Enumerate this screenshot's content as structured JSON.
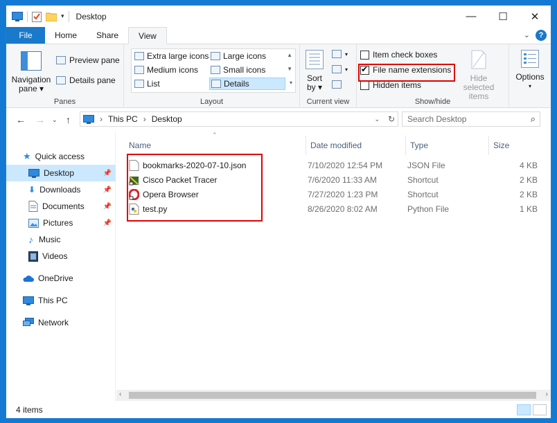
{
  "window": {
    "title": "Desktop",
    "minimize": "—",
    "maximize": "☐",
    "close": "✕"
  },
  "tabs": [
    {
      "label": "File"
    },
    {
      "label": "Home"
    },
    {
      "label": "Share"
    },
    {
      "label": "View"
    }
  ],
  "ribbon": {
    "panes": {
      "navigation_pane": "Navigation",
      "navigation_pane_2": "pane",
      "preview_pane": "Preview pane",
      "details_pane": "Details pane",
      "group_label": "Panes"
    },
    "layout": {
      "items": [
        "Extra large icons",
        "Large icons",
        "Medium icons",
        "Small icons",
        "List",
        "Details"
      ],
      "selected": "Details",
      "group_label": "Layout"
    },
    "current_view": {
      "sort_by": "Sort",
      "sort_by_2": "by",
      "group_label": "Current view"
    },
    "show_hide": {
      "item_check_boxes": "Item check boxes",
      "item_check_boxes_checked": false,
      "file_name_extensions": "File name extensions",
      "file_name_extensions_checked": true,
      "hidden_items": "Hidden items",
      "hidden_items_checked": false,
      "hide_selected": "Hide selected",
      "hide_selected_2": "items",
      "group_label": "Show/hide"
    },
    "options": {
      "label": "Options"
    }
  },
  "address": {
    "crumbs": [
      "This PC",
      "Desktop"
    ],
    "search_placeholder": "Search Desktop"
  },
  "nav": {
    "items": [
      {
        "label": "Quick access",
        "pinned": false
      },
      {
        "label": "Desktop",
        "pinned": true,
        "selected": true
      },
      {
        "label": "Downloads",
        "pinned": true
      },
      {
        "label": "Documents",
        "pinned": true
      },
      {
        "label": "Pictures",
        "pinned": true
      },
      {
        "label": "Music",
        "pinned": false
      },
      {
        "label": "Videos",
        "pinned": false
      },
      {
        "label": "OneDrive",
        "pinned": false
      },
      {
        "label": "This PC",
        "pinned": false
      },
      {
        "label": "Network",
        "pinned": false
      }
    ]
  },
  "columns": [
    "Name",
    "Date modified",
    "Type",
    "Size"
  ],
  "files": [
    {
      "name": "bookmarks-2020-07-10.json",
      "date": "7/10/2020 12:54 PM",
      "type": "JSON File",
      "size": "4 KB"
    },
    {
      "name": "Cisco Packet Tracer",
      "date": "7/6/2020 11:33 AM",
      "type": "Shortcut",
      "size": "2 KB"
    },
    {
      "name": "Opera Browser",
      "date": "7/27/2020 1:23 PM",
      "type": "Shortcut",
      "size": "2 KB"
    },
    {
      "name": "test.py",
      "date": "8/26/2020 8:02 AM",
      "type": "Python File",
      "size": "1 KB"
    }
  ],
  "status": {
    "item_count": "4 items"
  },
  "colors": {
    "accent": "#1979ca",
    "highlight": "#cce8ff",
    "annotation": "#e00000"
  }
}
